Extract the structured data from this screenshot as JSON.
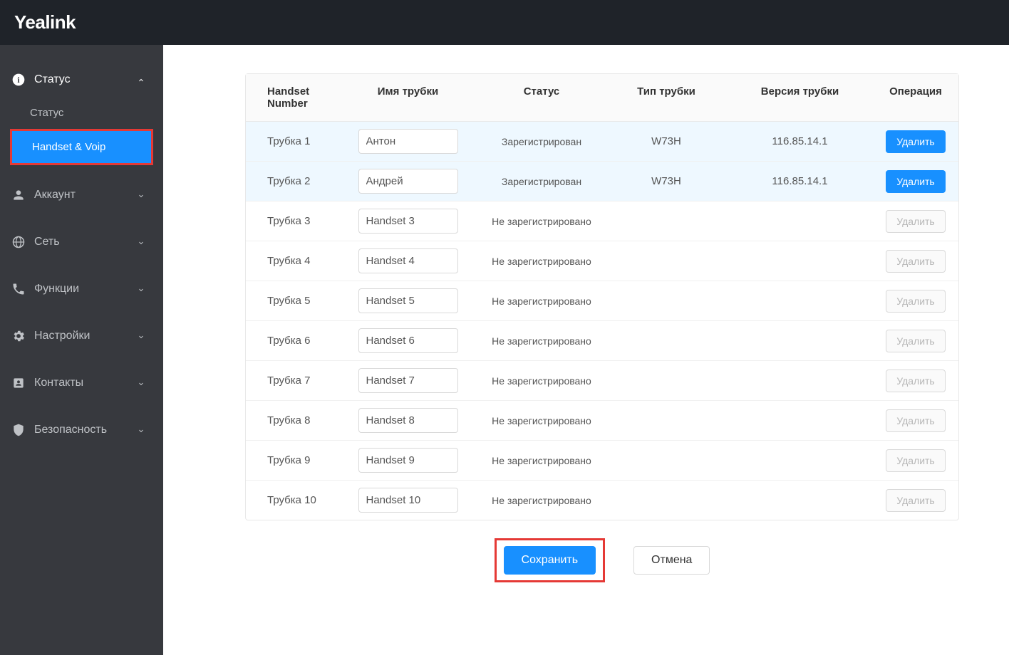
{
  "brand": "Yealink",
  "sidebar": {
    "items": [
      {
        "label": "Статус",
        "iconName": "info-icon",
        "expanded": true
      },
      {
        "label": "Аккаунт",
        "iconName": "account-icon",
        "expanded": false
      },
      {
        "label": "Сеть",
        "iconName": "network-icon",
        "expanded": false
      },
      {
        "label": "Функции",
        "iconName": "phone-icon",
        "expanded": false
      },
      {
        "label": "Настройки",
        "iconName": "gear-icon",
        "expanded": false
      },
      {
        "label": "Контакты",
        "iconName": "contacts-icon",
        "expanded": false
      },
      {
        "label": "Безопасность",
        "iconName": "shield-icon",
        "expanded": false
      }
    ],
    "subItems": [
      {
        "label": "Статус",
        "active": false
      },
      {
        "label": "Handset & Voip",
        "active": true
      }
    ]
  },
  "table": {
    "headers": {
      "handset_number": "Handset Number",
      "name": "Имя трубки",
      "status": "Статус",
      "type": "Тип трубки",
      "version": "Версия трубки",
      "operation": "Операция"
    },
    "rows": [
      {
        "number": "Трубка 1",
        "name": "Антон",
        "status": "Зарегистрирован",
        "type": "W73H",
        "version": "116.85.14.1",
        "registered": true
      },
      {
        "number": "Трубка 2",
        "name": "Андрей",
        "status": "Зарегистрирован",
        "type": "W73H",
        "version": "116.85.14.1",
        "registered": true
      },
      {
        "number": "Трубка 3",
        "name": "Handset 3",
        "status": "Не зарегистрировано",
        "type": "",
        "version": "",
        "registered": false
      },
      {
        "number": "Трубка 4",
        "name": "Handset 4",
        "status": "Не зарегистрировано",
        "type": "",
        "version": "",
        "registered": false
      },
      {
        "number": "Трубка 5",
        "name": "Handset 5",
        "status": "Не зарегистрировано",
        "type": "",
        "version": "",
        "registered": false
      },
      {
        "number": "Трубка 6",
        "name": "Handset 6",
        "status": "Не зарегистрировано",
        "type": "",
        "version": "",
        "registered": false
      },
      {
        "number": "Трубка 7",
        "name": "Handset 7",
        "status": "Не зарегистрировано",
        "type": "",
        "version": "",
        "registered": false
      },
      {
        "number": "Трубка 8",
        "name": "Handset 8",
        "status": "Не зарегистрировано",
        "type": "",
        "version": "",
        "registered": false
      },
      {
        "number": "Трубка 9",
        "name": "Handset 9",
        "status": "Не зарегистрировано",
        "type": "",
        "version": "",
        "registered": false
      },
      {
        "number": "Трубка 10",
        "name": "Handset 10",
        "status": "Не зарегистрировано",
        "type": "",
        "version": "",
        "registered": false
      }
    ],
    "delete_label": "Удалить"
  },
  "actions": {
    "save": "Сохранить",
    "cancel": "Отмена"
  }
}
